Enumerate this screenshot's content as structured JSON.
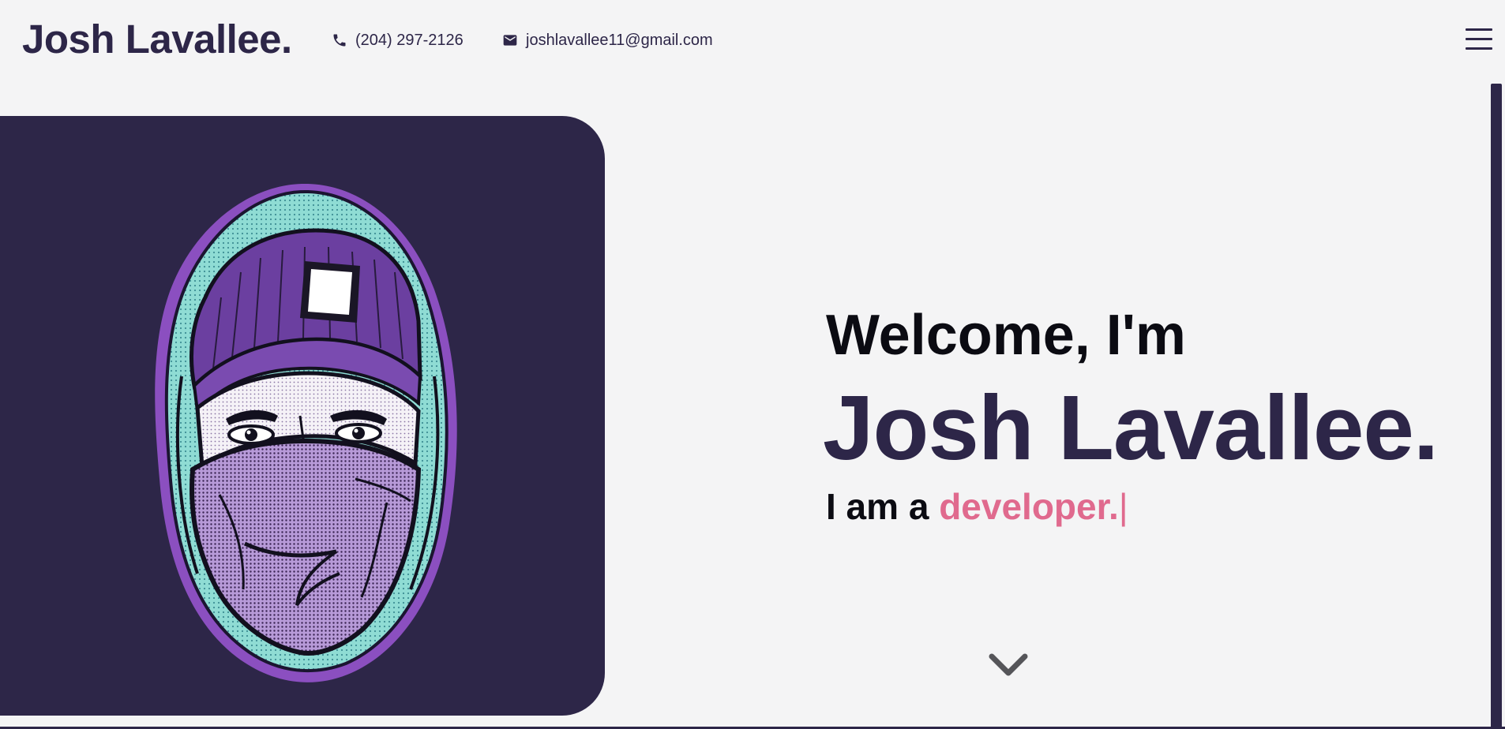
{
  "header": {
    "brand": "Josh Lavallee.",
    "phone": "(204) 297-2126",
    "email": "joshlavallee11@gmail.com",
    "phone_icon": "phone-icon",
    "email_icon": "mail-icon",
    "menu_icon": "hamburger-menu-icon"
  },
  "hero": {
    "welcome": "Welcome, I'm",
    "name": "Josh Lavallee.",
    "tagline_prefix": "I am a",
    "role": "developer.",
    "cursor": "|",
    "portrait": "hooded-masked-portrait-illustration",
    "scroll_icon": "chevron-down-icon"
  },
  "colors": {
    "background": "#f4f4f5",
    "brand_dark": "#2d2648",
    "accent_pink": "#e06a8e",
    "portrait_teal": "#7fd6cf",
    "portrait_purple": "#8b5fc2"
  }
}
